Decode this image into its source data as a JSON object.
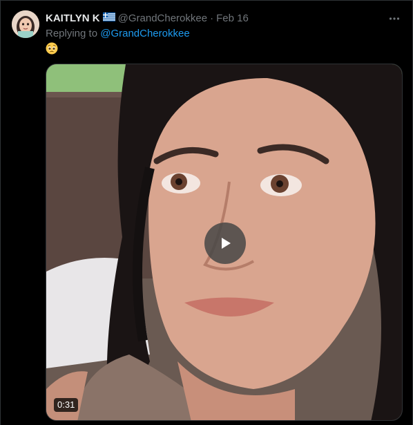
{
  "tweet": {
    "author_name": "KAITLYN K",
    "author_flag": "greece-flag-icon",
    "handle": "@GrandCherokkee",
    "separator": "·",
    "date": "Feb 16",
    "replying_prefix": "Replying to",
    "replying_to": "@GrandCherokkee",
    "text_emoji": "pleading-face-emoji",
    "video": {
      "duration": "0:31",
      "play_icon": "play-icon"
    },
    "more_icon": "more-horizontal-icon"
  },
  "colors": {
    "background": "#000000",
    "primary_text": "#e7e9ea",
    "secondary_text": "#71767b",
    "link": "#1d9bf0",
    "border": "#2f3336"
  }
}
